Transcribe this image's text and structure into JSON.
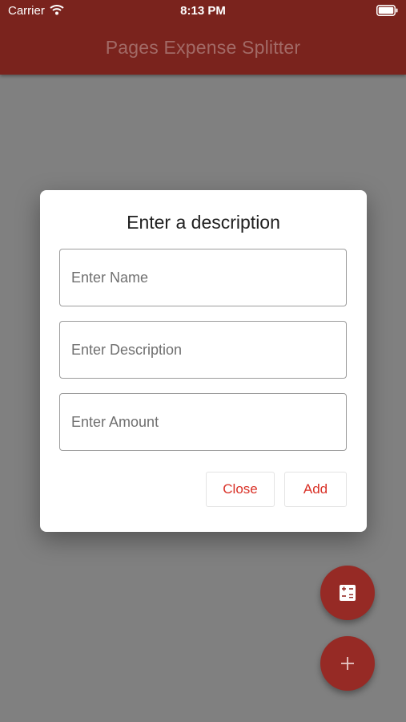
{
  "status_bar": {
    "carrier": "Carrier",
    "time": "8:13 PM",
    "wifi_icon": "wifi-icon",
    "battery_icon": "battery-icon"
  },
  "app_bar": {
    "title": "Pages Expense Splitter",
    "color": "#7a231d"
  },
  "dialog": {
    "title": "Enter a description",
    "fields": {
      "name": {
        "placeholder": "Enter Name",
        "value": ""
      },
      "description": {
        "placeholder": "Enter Description",
        "value": ""
      },
      "amount": {
        "placeholder": "Enter Amount",
        "value": ""
      }
    },
    "buttons": {
      "close": "Close",
      "add": "Add"
    },
    "accent": "#d93026"
  },
  "fabs": [
    {
      "icon": "calculator-icon"
    },
    {
      "icon": "plus-icon"
    }
  ]
}
